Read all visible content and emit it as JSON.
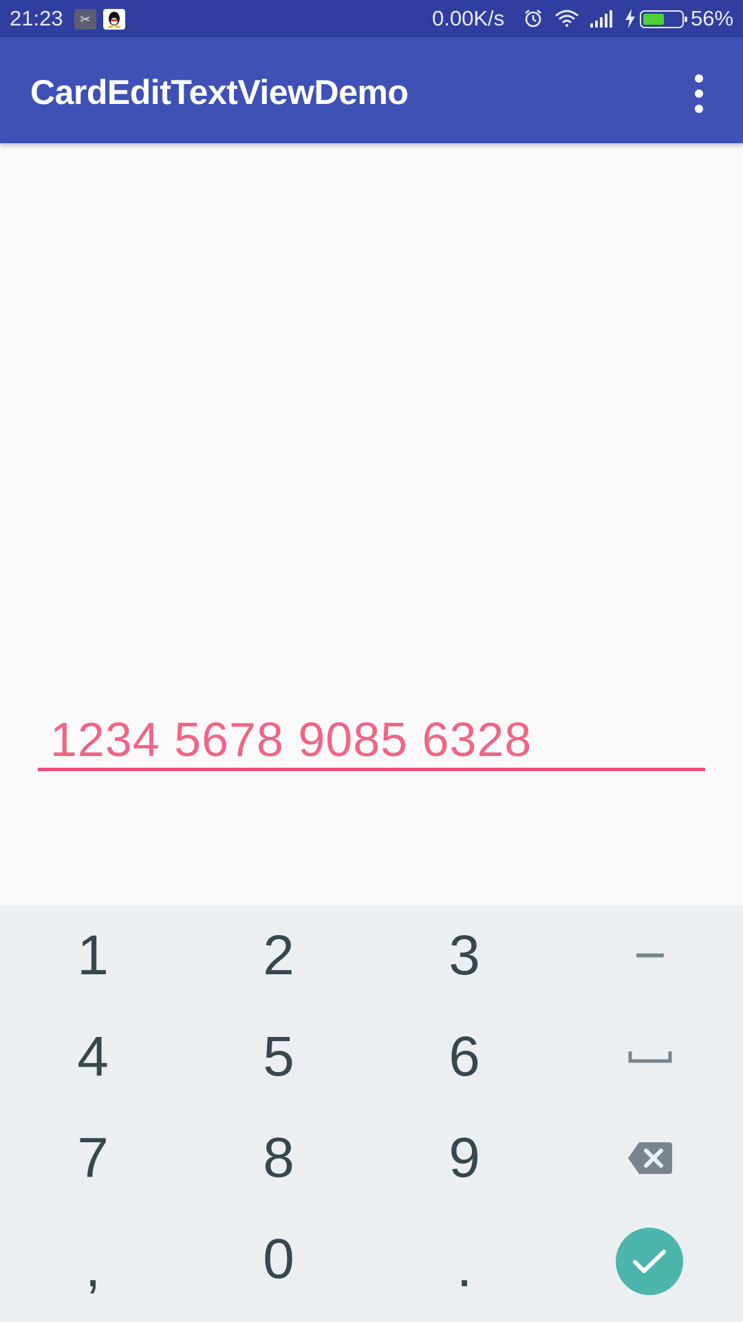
{
  "status_bar": {
    "time": "21:23",
    "network_speed": "0.00K/s",
    "battery_percent": "56%",
    "battery_level": 0.56,
    "icons": [
      "screenshot-icon",
      "qq-icon",
      "alarm-icon",
      "wifi-icon",
      "signal-icon",
      "charging-icon",
      "battery-icon"
    ]
  },
  "app_bar": {
    "title": "CardEditTextViewDemo",
    "overflow_icon": "more-vert-icon"
  },
  "card_input": {
    "value": "1234 5678 9085 6328",
    "text_color": "#f06586",
    "underline_color": "#f04d7e"
  },
  "keypad": {
    "rows": [
      [
        "1",
        "2",
        "3",
        "−"
      ],
      [
        "4",
        "5",
        "6",
        "space"
      ],
      [
        "7",
        "8",
        "9",
        "backspace"
      ],
      [
        ",",
        "0",
        ".",
        "done"
      ]
    ],
    "labels": {
      "k1": "1",
      "k2": "2",
      "k3": "3",
      "minus": "−",
      "k4": "4",
      "k5": "5",
      "k6": "6",
      "k7": "7",
      "k8": "8",
      "k9": "9",
      "comma": ",",
      "k0": "0",
      "dot": "."
    },
    "space_icon": "space-bar-icon",
    "backspace_icon": "backspace-icon",
    "done_icon": "check-icon",
    "done_color": "#4db6ac",
    "background": "#eceff1"
  },
  "colors": {
    "primary": "#3f51b5",
    "primary_dark": "#303f9f",
    "accent": "#f04d7e"
  }
}
